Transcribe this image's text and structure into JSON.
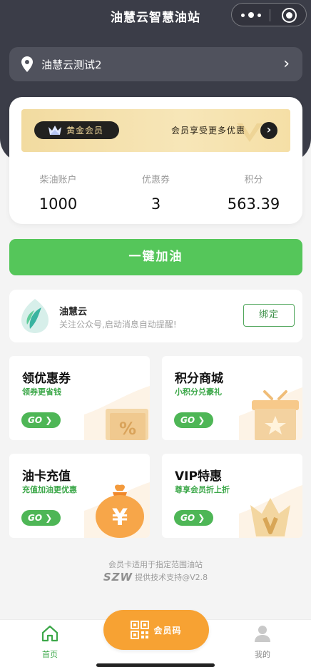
{
  "header": {
    "title": "油慧云智慧油站"
  },
  "station": {
    "name": "油慧云测试2"
  },
  "member": {
    "level_label": "黄金会员",
    "promo_text": "会员享受更多优惠",
    "stats": [
      {
        "label": "柴油账户",
        "value": "1000"
      },
      {
        "label": "优惠券",
        "value": "3"
      },
      {
        "label": "积分",
        "value": "563.39"
      }
    ]
  },
  "refuel_button": "一键加油",
  "follow": {
    "name": "油慧云",
    "desc": "关注公众号,启动消息自动提醒!",
    "bind_label": "绑定"
  },
  "tiles": [
    {
      "title": "领优惠券",
      "subtitle": "领券更省钱",
      "go": "GO"
    },
    {
      "title": "积分商城",
      "subtitle": "小积分兑豪礼",
      "go": "GO"
    },
    {
      "title": "油卡充值",
      "subtitle": "充值加油更优惠",
      "go": "GO"
    },
    {
      "title": "VIP特惠",
      "subtitle": "尊享会员折上折",
      "go": "GO"
    }
  ],
  "footer": {
    "note": "会员卡适用于指定范围油站",
    "brand": "SZW",
    "support": "提供技术支持@V2.8"
  },
  "tabbar": {
    "home": "首页",
    "member_code": "会员码",
    "mine": "我的"
  },
  "colors": {
    "accent_green": "#55c65a",
    "header_bg": "#3b3d48",
    "gold": "#f2dba0",
    "orange": "#f7a233"
  }
}
